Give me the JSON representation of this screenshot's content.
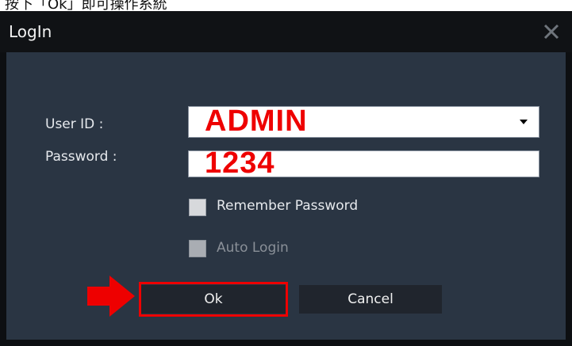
{
  "top_strip": {
    "text": "按下「Ok」即可操作系統"
  },
  "dialog": {
    "title": "LogIn",
    "close_icon": "close-icon",
    "user_id": {
      "label": "User ID :",
      "value": "ADMIN"
    },
    "password": {
      "label": "Password :",
      "value": "1234"
    },
    "remember_password": {
      "label": "Remember Password",
      "checked": false
    },
    "auto_login": {
      "label": "Auto Login",
      "checked": false,
      "disabled": true
    },
    "buttons": {
      "ok": "Ok",
      "cancel": "Cancel"
    }
  },
  "annotations": {
    "highlight_color": "#ee0000",
    "arrow_icon": "right-arrow-icon"
  }
}
